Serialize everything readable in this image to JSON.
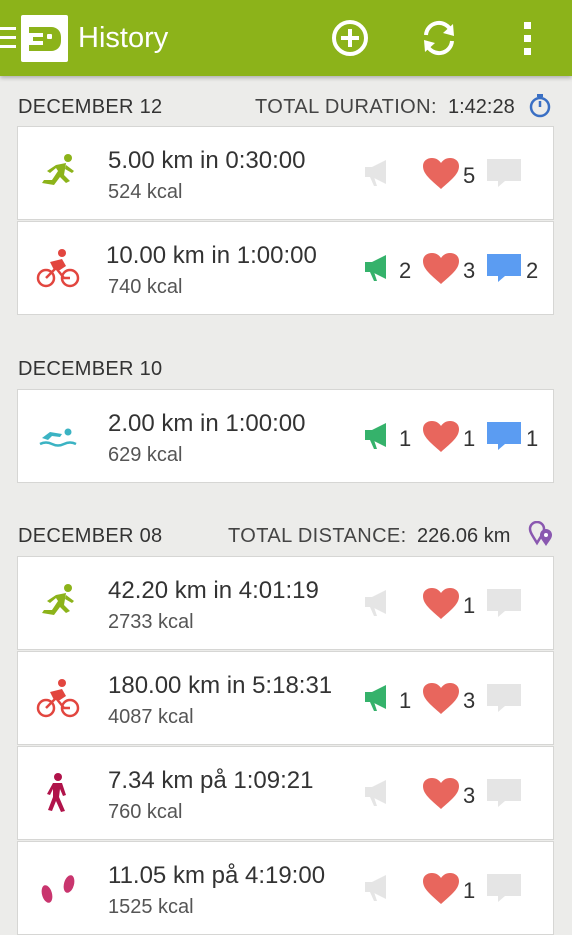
{
  "appbar": {
    "title": "History",
    "actions": [
      "add-icon",
      "sync-icon",
      "more-icon"
    ],
    "color": "#8cb31a"
  },
  "days": [
    {
      "date": "DECEMBER 12",
      "total_label": "TOTAL DURATION:",
      "total_value": "1:42:28",
      "total_icon": "stopwatch-icon",
      "workouts": [
        {
          "sport": "running",
          "title": "5.00 km in 0:30:00",
          "kcal": "524 kcal",
          "peptalks": "",
          "likes": "5",
          "comments": "",
          "peptalk_active": false,
          "comment_active": false
        },
        {
          "sport": "cycling",
          "title": "10.00 km in 1:00:00",
          "kcal": "740 kcal",
          "peptalks": "2",
          "likes": "3",
          "comments": "2",
          "peptalk_active": true,
          "comment_active": true
        }
      ]
    },
    {
      "date": "DECEMBER 10",
      "total_label": "",
      "total_value": "",
      "workouts": [
        {
          "sport": "swimming",
          "title": "2.00 km in 1:00:00",
          "kcal": "629 kcal",
          "peptalks": "1",
          "likes": "1",
          "comments": "1",
          "peptalk_active": true,
          "comment_active": true
        }
      ]
    },
    {
      "date": "DECEMBER 08",
      "total_label": "TOTAL DISTANCE:",
      "total_value": "226.06 km",
      "total_icon": "map-pins-icon",
      "workouts": [
        {
          "sport": "running",
          "title": "42.20 km in 4:01:19",
          "kcal": "2733 kcal",
          "peptalks": "",
          "likes": "1",
          "comments": "",
          "peptalk_active": false,
          "comment_active": false
        },
        {
          "sport": "cycling",
          "title": "180.00 km in 5:18:31",
          "kcal": "4087 kcal",
          "peptalks": "1",
          "likes": "3",
          "comments": "",
          "peptalk_active": true,
          "comment_active": false
        },
        {
          "sport": "walking",
          "title": "7.34 km på 1:09:21",
          "kcal": "760 kcal",
          "peptalks": "",
          "likes": "3",
          "comments": "",
          "peptalk_active": false,
          "comment_active": false
        },
        {
          "sport": "hiking",
          "title": "11.05 km på 4:19:00",
          "kcal": "1525 kcal",
          "peptalks": "",
          "likes": "1",
          "comments": "",
          "peptalk_active": false,
          "comment_active": false
        }
      ]
    }
  ],
  "colors": {
    "running": "#8cb31a",
    "cycling": "#e2463f",
    "swimming": "#3bb3c3",
    "walking": "#b0134a",
    "hiking": "#c9356e",
    "peptalk": "#35b26b",
    "like": "#e8665d",
    "comment": "#5b9cf2",
    "inactive": "#e5e5e5"
  }
}
